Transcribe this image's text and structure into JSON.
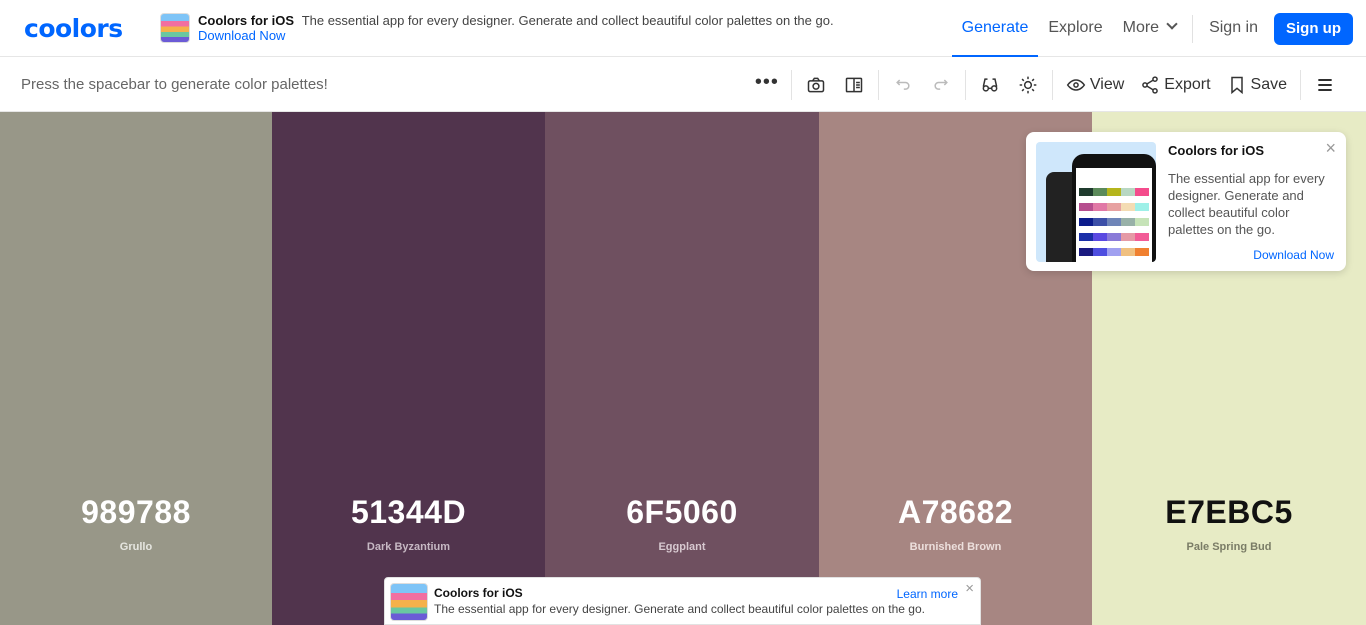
{
  "brand": {
    "logo": "coolors",
    "accent": "#0066ff"
  },
  "promo": {
    "title": "Coolors for iOS",
    "description": "The essential app for every designer. Generate and collect beautiful color palettes on the go.",
    "link": "Download Now"
  },
  "nav": {
    "generate": "Generate",
    "explore": "Explore",
    "more": "More",
    "signin": "Sign in",
    "signup": "Sign up"
  },
  "toolbar": {
    "hint": "Press the spacebar to generate color palettes!",
    "view": "View",
    "export": "Export",
    "save": "Save",
    "icons": [
      "more-dots-icon",
      "camera-icon",
      "layout-icon",
      "undo-icon",
      "redo-icon",
      "glasses-icon",
      "sun-icon",
      "eye-icon",
      "share-icon",
      "bookmark-icon",
      "hamburger-menu-icon"
    ]
  },
  "palette": [
    {
      "hex": "989788",
      "name": "Grullo",
      "bg": "#989788",
      "text": "#ffffff",
      "sub": "#e6e6e0"
    },
    {
      "hex": "51344D",
      "name": "Dark Byzantium",
      "bg": "#51344d",
      "text": "#ffffff",
      "sub": "#c6b8c3"
    },
    {
      "hex": "6F5060",
      "name": "Eggplant",
      "bg": "#6f5060",
      "text": "#ffffff",
      "sub": "#d7c9d0"
    },
    {
      "hex": "A78682",
      "name": "Burnished Brown",
      "bg": "#a78682",
      "text": "#ffffff",
      "sub": "#ecdfdc"
    },
    {
      "hex": "E7EBC5",
      "name": "Pale Spring Bud",
      "bg": "#e7ebc5",
      "text": "#111111",
      "sub": "#7a7c66"
    }
  ],
  "card": {
    "title": "Coolors for iOS",
    "description": "The essential app for every designer. Generate and collect beautiful color palettes on the go.",
    "link": "Download Now",
    "close": "×"
  },
  "banner": {
    "title": "Coolors for iOS",
    "description": "The essential app for every designer. Generate and collect beautiful color palettes on the go.",
    "link": "Learn more",
    "close": "×"
  }
}
